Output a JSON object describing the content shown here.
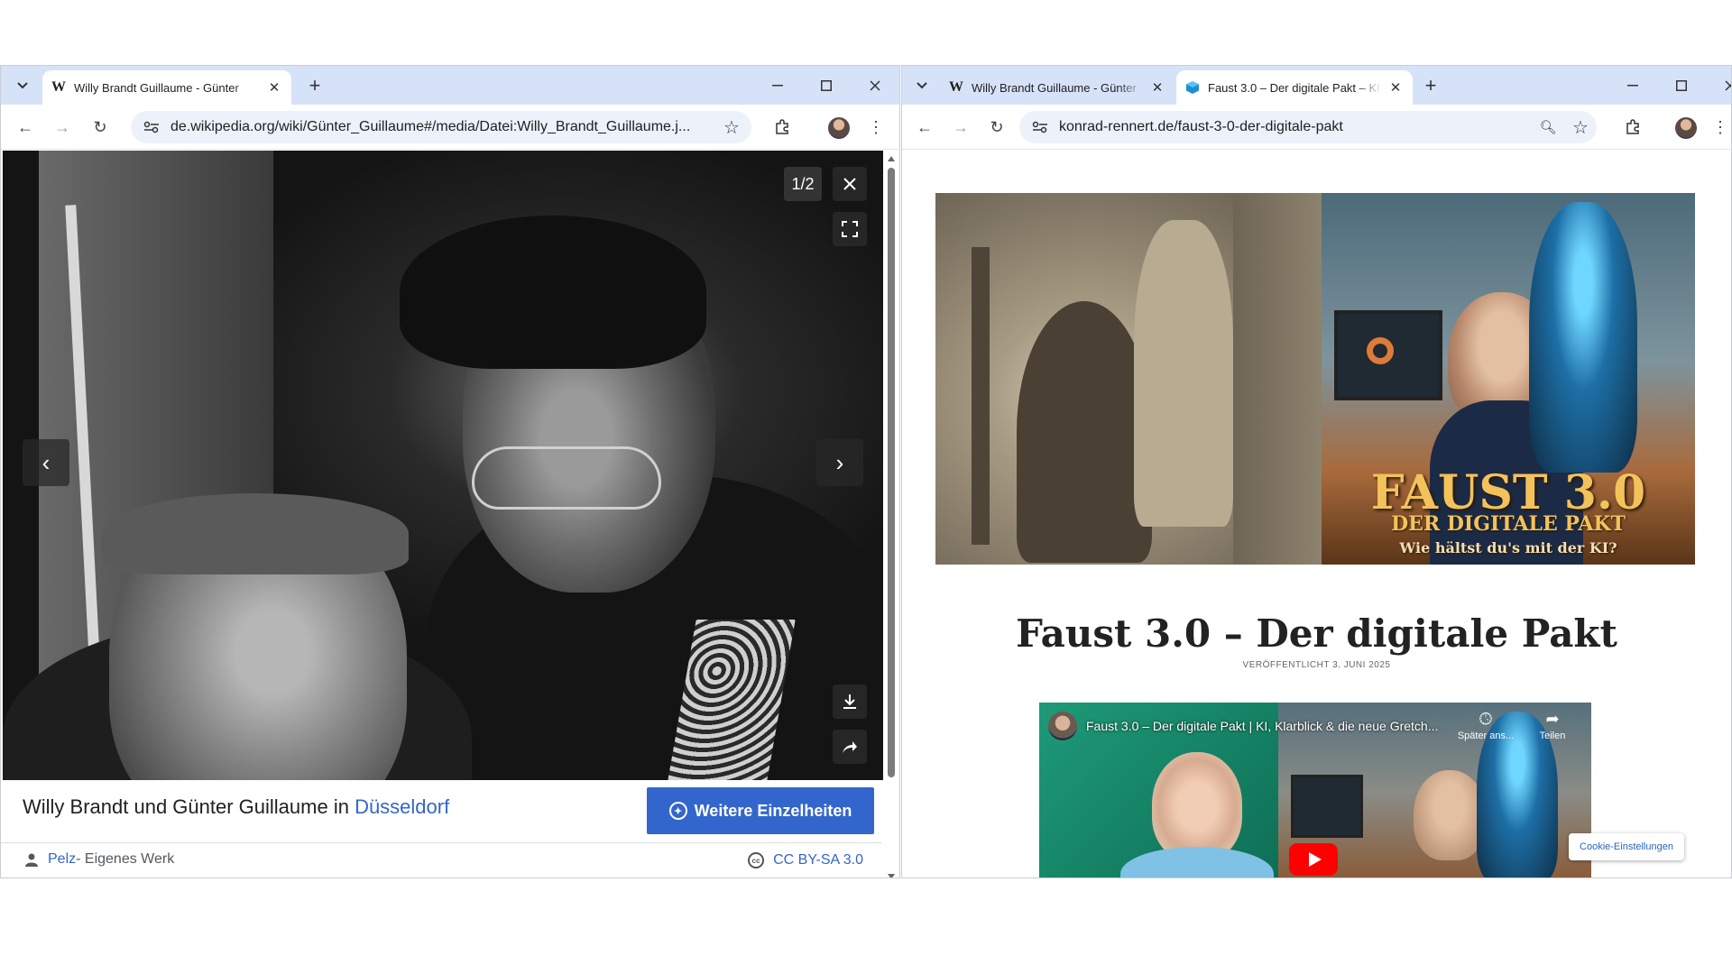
{
  "left_window": {
    "tabs": [
      {
        "favicon": "W",
        "title": "Willy Brandt Guillaume - Günter",
        "active": true
      }
    ],
    "url": "de.wikipedia.org/wiki/Günter_Guillaume#/media/Datei:Willy_Brandt_Guillaume.j...",
    "viewer": {
      "counter": "1/2",
      "caption_prefix": "Willy Brandt und Günter Guillaume in ",
      "caption_link": "Düsseldorf",
      "more_button": "Weitere Einzelheiten",
      "author": "Pelz",
      "author_suffix": " - Eigenes Werk",
      "license": "CC BY-SA 3.0"
    }
  },
  "right_window": {
    "tabs": [
      {
        "favicon": "W",
        "title": "Willy Brandt Guillaume - Günter",
        "active": false
      },
      {
        "favicon": "cube",
        "title": "Faust 3.0 – Der digitale Pakt – KI",
        "active": true
      }
    ],
    "url": "konrad-rennert.de/faust-3-0-der-digitale-pakt",
    "hero": {
      "line1": "FAUST 3.0",
      "line2": "DER DIGITALE PAKT",
      "line3": "Wie hältst du's mit der KI?"
    },
    "post_title": "Faust 3.0 – Der digitale Pakt",
    "post_date": "VERÖFFENTLICHT 3. JUNI 2025",
    "video": {
      "title": "Faust 3.0 – Der digitale Pakt | KI, Klarblick & die neue Gretch...",
      "watch_later": "Später ans...",
      "share": "Teilen"
    },
    "cookie_button": "Cookie-Einstellungen"
  },
  "colors": {
    "tabbar": "#d6e2f8",
    "omnibox": "#edf2fa",
    "wiki_link": "#3366cc",
    "hero_gold": "#f3c25a",
    "youtube_red": "#ff0000"
  }
}
